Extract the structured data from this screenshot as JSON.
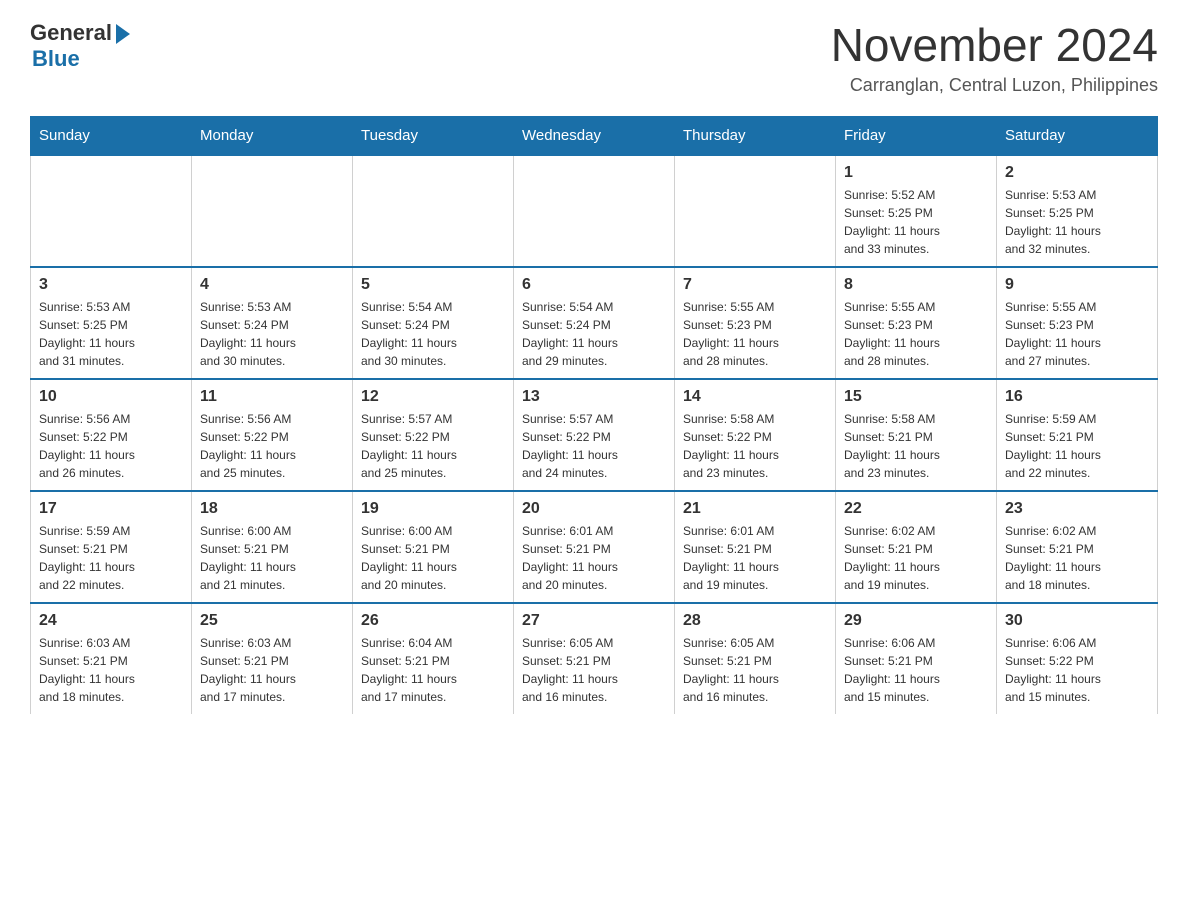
{
  "header": {
    "logo": {
      "general": "General",
      "blue": "Blue"
    },
    "title": "November 2024",
    "location": "Carranglan, Central Luzon, Philippines"
  },
  "calendar": {
    "days_of_week": [
      "Sunday",
      "Monday",
      "Tuesday",
      "Wednesday",
      "Thursday",
      "Friday",
      "Saturday"
    ],
    "weeks": [
      [
        {
          "day": "",
          "info": ""
        },
        {
          "day": "",
          "info": ""
        },
        {
          "day": "",
          "info": ""
        },
        {
          "day": "",
          "info": ""
        },
        {
          "day": "",
          "info": ""
        },
        {
          "day": "1",
          "info": "Sunrise: 5:52 AM\nSunset: 5:25 PM\nDaylight: 11 hours\nand 33 minutes."
        },
        {
          "day": "2",
          "info": "Sunrise: 5:53 AM\nSunset: 5:25 PM\nDaylight: 11 hours\nand 32 minutes."
        }
      ],
      [
        {
          "day": "3",
          "info": "Sunrise: 5:53 AM\nSunset: 5:25 PM\nDaylight: 11 hours\nand 31 minutes."
        },
        {
          "day": "4",
          "info": "Sunrise: 5:53 AM\nSunset: 5:24 PM\nDaylight: 11 hours\nand 30 minutes."
        },
        {
          "day": "5",
          "info": "Sunrise: 5:54 AM\nSunset: 5:24 PM\nDaylight: 11 hours\nand 30 minutes."
        },
        {
          "day": "6",
          "info": "Sunrise: 5:54 AM\nSunset: 5:24 PM\nDaylight: 11 hours\nand 29 minutes."
        },
        {
          "day": "7",
          "info": "Sunrise: 5:55 AM\nSunset: 5:23 PM\nDaylight: 11 hours\nand 28 minutes."
        },
        {
          "day": "8",
          "info": "Sunrise: 5:55 AM\nSunset: 5:23 PM\nDaylight: 11 hours\nand 28 minutes."
        },
        {
          "day": "9",
          "info": "Sunrise: 5:55 AM\nSunset: 5:23 PM\nDaylight: 11 hours\nand 27 minutes."
        }
      ],
      [
        {
          "day": "10",
          "info": "Sunrise: 5:56 AM\nSunset: 5:22 PM\nDaylight: 11 hours\nand 26 minutes."
        },
        {
          "day": "11",
          "info": "Sunrise: 5:56 AM\nSunset: 5:22 PM\nDaylight: 11 hours\nand 25 minutes."
        },
        {
          "day": "12",
          "info": "Sunrise: 5:57 AM\nSunset: 5:22 PM\nDaylight: 11 hours\nand 25 minutes."
        },
        {
          "day": "13",
          "info": "Sunrise: 5:57 AM\nSunset: 5:22 PM\nDaylight: 11 hours\nand 24 minutes."
        },
        {
          "day": "14",
          "info": "Sunrise: 5:58 AM\nSunset: 5:22 PM\nDaylight: 11 hours\nand 23 minutes."
        },
        {
          "day": "15",
          "info": "Sunrise: 5:58 AM\nSunset: 5:21 PM\nDaylight: 11 hours\nand 23 minutes."
        },
        {
          "day": "16",
          "info": "Sunrise: 5:59 AM\nSunset: 5:21 PM\nDaylight: 11 hours\nand 22 minutes."
        }
      ],
      [
        {
          "day": "17",
          "info": "Sunrise: 5:59 AM\nSunset: 5:21 PM\nDaylight: 11 hours\nand 22 minutes."
        },
        {
          "day": "18",
          "info": "Sunrise: 6:00 AM\nSunset: 5:21 PM\nDaylight: 11 hours\nand 21 minutes."
        },
        {
          "day": "19",
          "info": "Sunrise: 6:00 AM\nSunset: 5:21 PM\nDaylight: 11 hours\nand 20 minutes."
        },
        {
          "day": "20",
          "info": "Sunrise: 6:01 AM\nSunset: 5:21 PM\nDaylight: 11 hours\nand 20 minutes."
        },
        {
          "day": "21",
          "info": "Sunrise: 6:01 AM\nSunset: 5:21 PM\nDaylight: 11 hours\nand 19 minutes."
        },
        {
          "day": "22",
          "info": "Sunrise: 6:02 AM\nSunset: 5:21 PM\nDaylight: 11 hours\nand 19 minutes."
        },
        {
          "day": "23",
          "info": "Sunrise: 6:02 AM\nSunset: 5:21 PM\nDaylight: 11 hours\nand 18 minutes."
        }
      ],
      [
        {
          "day": "24",
          "info": "Sunrise: 6:03 AM\nSunset: 5:21 PM\nDaylight: 11 hours\nand 18 minutes."
        },
        {
          "day": "25",
          "info": "Sunrise: 6:03 AM\nSunset: 5:21 PM\nDaylight: 11 hours\nand 17 minutes."
        },
        {
          "day": "26",
          "info": "Sunrise: 6:04 AM\nSunset: 5:21 PM\nDaylight: 11 hours\nand 17 minutes."
        },
        {
          "day": "27",
          "info": "Sunrise: 6:05 AM\nSunset: 5:21 PM\nDaylight: 11 hours\nand 16 minutes."
        },
        {
          "day": "28",
          "info": "Sunrise: 6:05 AM\nSunset: 5:21 PM\nDaylight: 11 hours\nand 16 minutes."
        },
        {
          "day": "29",
          "info": "Sunrise: 6:06 AM\nSunset: 5:21 PM\nDaylight: 11 hours\nand 15 minutes."
        },
        {
          "day": "30",
          "info": "Sunrise: 6:06 AM\nSunset: 5:22 PM\nDaylight: 11 hours\nand 15 minutes."
        }
      ]
    ]
  }
}
